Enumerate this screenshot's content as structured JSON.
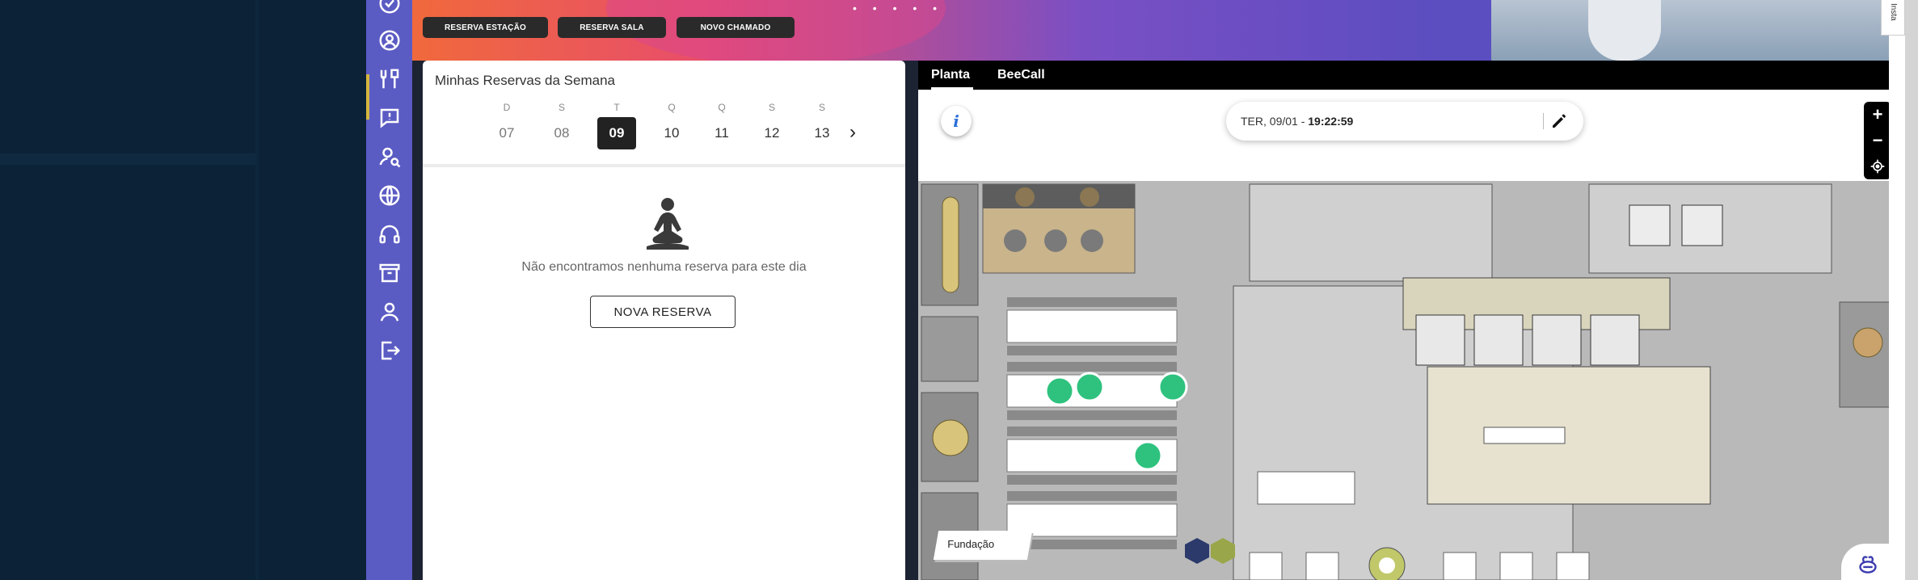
{
  "actions": {
    "reserve_station": "RESERVA ESTAÇÃO",
    "reserve_room": "RESERVA SALA",
    "new_ticket": "NOVO CHAMADO"
  },
  "reservations": {
    "title": "Minhas Reservas da Semana",
    "days": [
      {
        "letter": "D",
        "num": "07"
      },
      {
        "letter": "S",
        "num": "08"
      },
      {
        "letter": "T",
        "num": "09"
      },
      {
        "letter": "Q",
        "num": "10"
      },
      {
        "letter": "Q",
        "num": "11"
      },
      {
        "letter": "S",
        "num": "12"
      },
      {
        "letter": "S",
        "num": "13"
      }
    ],
    "selected_day": "09",
    "empty_message": "Não encontramos nenhuma reserva para este dia",
    "new_reservation": "NOVA RESERVA"
  },
  "plan": {
    "tabs": [
      "Planta",
      "BeeCall"
    ],
    "active_tab": "Planta",
    "date_label": "TER, 09/01 - ",
    "time_label": "19:22:59",
    "zoom_in": "+",
    "zoom_out": "−",
    "area_label": "Fundação",
    "info_glyph": "i"
  },
  "edge_tab": "Insta",
  "colors": {
    "rail": "#5b5bc4",
    "desk_marker": "#2ec27e",
    "selected_day_bg": "#222222"
  }
}
